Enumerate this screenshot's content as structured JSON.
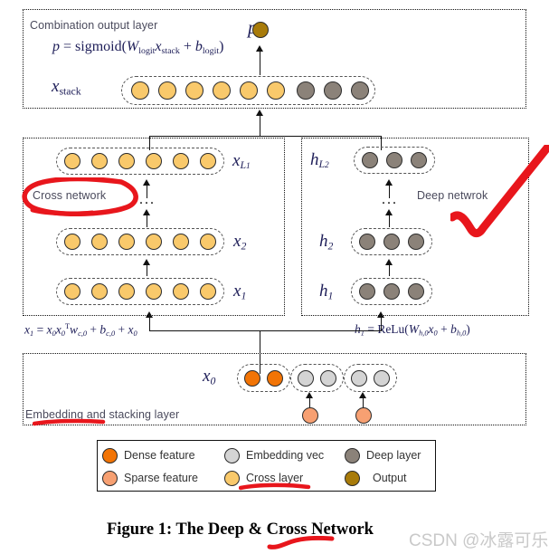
{
  "figure": {
    "caption": "Figure 1: The Deep & Cross Network",
    "watermark": "CSDN @冰露可乐"
  },
  "colors": {
    "dense_feature": "#f27405",
    "sparse_feature": "#f7a072",
    "embedding_vec": "#d4d4d4",
    "cross_layer": "#f9c96b",
    "deep_layer": "#8b8279",
    "output": "#a87b0a",
    "ink_red": "#e8161c",
    "box_border": "#111111",
    "pill_border": "#555555"
  },
  "panels": {
    "combination": {
      "label": "Combination output layer",
      "p_symbol": "p",
      "formula": "p = sigmoid(W_logit x_stack + b_logit)",
      "stack_symbol": "x_stack",
      "stack_nodes": [
        "cross",
        "cross",
        "cross",
        "cross",
        "cross",
        "cross",
        "deep",
        "deep",
        "deep"
      ]
    },
    "cross_network": {
      "label": "Cross network",
      "rows": [
        {
          "symbol": "x_L1",
          "count": 6,
          "kind": "cross"
        },
        {
          "symbol": "x_2",
          "count": 6,
          "kind": "cross"
        },
        {
          "symbol": "x_1",
          "count": 6,
          "kind": "cross"
        }
      ],
      "ellipsis": "...",
      "formula": "x_1 = x_0 x_0^T w_c,0 + b_c,0 + x_0"
    },
    "deep_network": {
      "label": "Deep netwrok",
      "rows": [
        {
          "symbol": "h_L2",
          "count": 3,
          "kind": "deep"
        },
        {
          "symbol": "h_2",
          "count": 3,
          "kind": "deep"
        },
        {
          "symbol": "h_1",
          "count": 3,
          "kind": "deep"
        }
      ],
      "ellipsis": "...",
      "formula": "h_1 = ReLu(W_h,0 x_0 + b_h,0)"
    },
    "embedding": {
      "label": "Embedding and stacking layer",
      "x0_symbol": "x_0",
      "groups": [
        {
          "nodes": [
            "dense",
            "dense"
          ]
        },
        {
          "nodes": [
            "embedding",
            "embedding"
          ]
        },
        {
          "nodes": [
            "embedding",
            "embedding"
          ]
        }
      ],
      "sparse_inputs": [
        "sparse",
        "sparse"
      ]
    }
  },
  "legend": {
    "items": [
      {
        "label": "Dense feature",
        "color_key": "dense_feature"
      },
      {
        "label": "Embedding vec",
        "color_key": "embedding_vec"
      },
      {
        "label": "Deep layer",
        "color_key": "deep_layer"
      },
      {
        "label": "Sparse feature",
        "color_key": "sparse_feature"
      },
      {
        "label": "Cross layer",
        "color_key": "cross_layer"
      },
      {
        "label": "Output",
        "color_key": "output"
      }
    ]
  },
  "annotations": [
    {
      "name": "cross-network-circle",
      "kind": "red-ellipse-around-text"
    },
    {
      "name": "deep-network-check",
      "kind": "red-check-stroke"
    },
    {
      "name": "embedding-underline",
      "kind": "red-underline"
    },
    {
      "name": "cross-layer-underline",
      "kind": "red-underline"
    },
    {
      "name": "caption-squiggle",
      "kind": "red-squiggle"
    }
  ]
}
